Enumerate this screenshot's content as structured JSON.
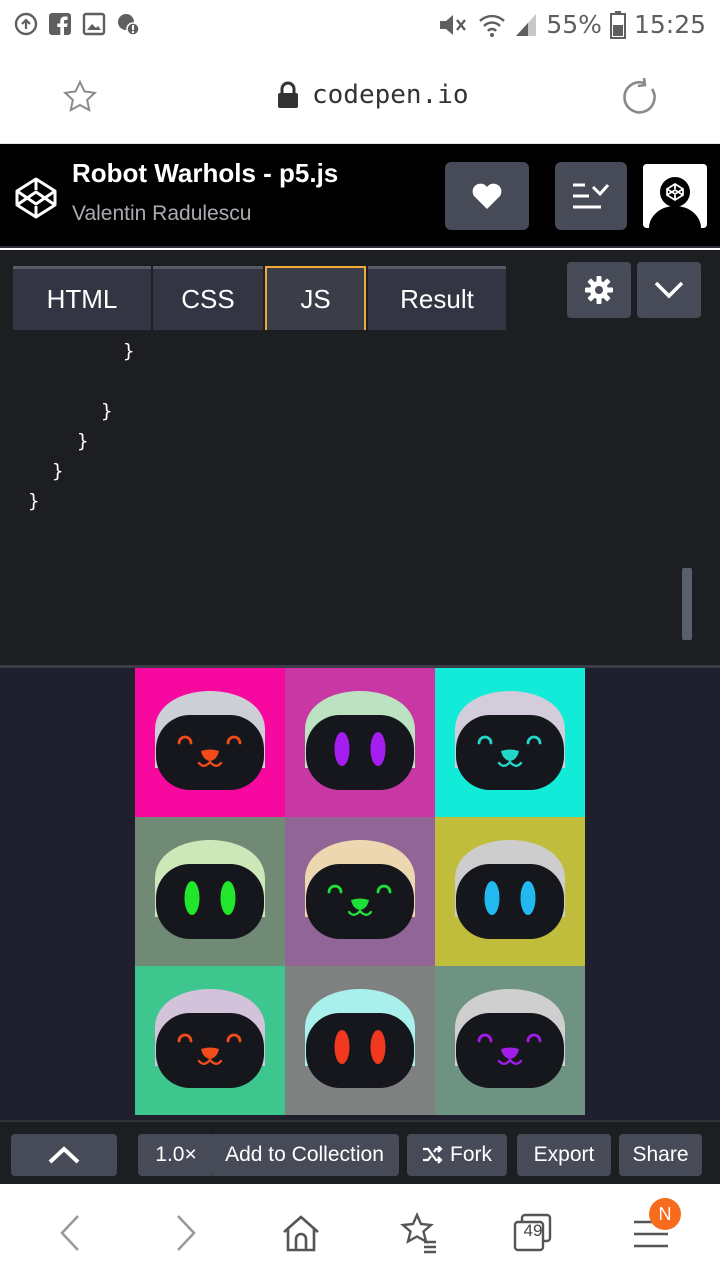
{
  "status_bar": {
    "battery_percent": "55%",
    "time": "15:25",
    "icons": [
      "data-saver-icon",
      "facebook-icon",
      "gallery-icon",
      "alert-icon",
      "mute-icon",
      "wifi-icon",
      "signal-icon",
      "battery-icon"
    ]
  },
  "browser": {
    "url": "codepen.io",
    "tab_count": "49",
    "notification_badge": "N",
    "accent_color": "#f76b1c"
  },
  "pen": {
    "title": "Robot Warhols - p5.js",
    "author": "Valentin Radulescu"
  },
  "tabs": {
    "html": "HTML",
    "css": "CSS",
    "js": "JS",
    "result": "Result",
    "active": "JS",
    "active_color": "#f2a93b"
  },
  "code_lines": [
    "}",
    "}",
    "}",
    "}",
    "}"
  ],
  "robots": [
    {
      "bg": "#f7099f",
      "dome": "#cccfd6",
      "eyes": "happy",
      "eye_color": "#f04b19",
      "mouth": true
    },
    {
      "bg": "#c837a3",
      "dome": "#bde2c2",
      "eyes": "oval",
      "eye_color": "#a61df0",
      "mouth": false
    },
    {
      "bg": "#12ebd8",
      "dome": "#d3ccdb",
      "eyes": "happy",
      "eye_color": "#22d6c9",
      "mouth": true
    },
    {
      "bg": "#718a76",
      "dome": "#cce8b8",
      "eyes": "oval",
      "eye_color": "#21e62b",
      "mouth": false
    },
    {
      "bg": "#916596",
      "dome": "#ecd7b1",
      "eyes": "happy",
      "eye_color": "#1fe037",
      "mouth": true
    },
    {
      "bg": "#c0bd3c",
      "dome": "#cdcdcd",
      "eyes": "oval",
      "eye_color": "#22b9f0",
      "mouth": false
    },
    {
      "bg": "#3ec68f",
      "dome": "#d2c2da",
      "eyes": "happy",
      "eye_color": "#f04c1c",
      "mouth": true
    },
    {
      "bg": "#7f8080",
      "dome": "#a9f0ec",
      "eyes": "oval",
      "eye_color": "#f2391f",
      "mouth": false
    },
    {
      "bg": "#6e9382",
      "dome": "#cfcfcf",
      "eyes": "happy",
      "eye_color": "#a21de6",
      "mouth": true
    }
  ],
  "bottom_bar": {
    "zoom": "1.0×",
    "add_to_collection": "Add to Collection",
    "fork": "Fork",
    "export": "Export",
    "share": "Share"
  }
}
